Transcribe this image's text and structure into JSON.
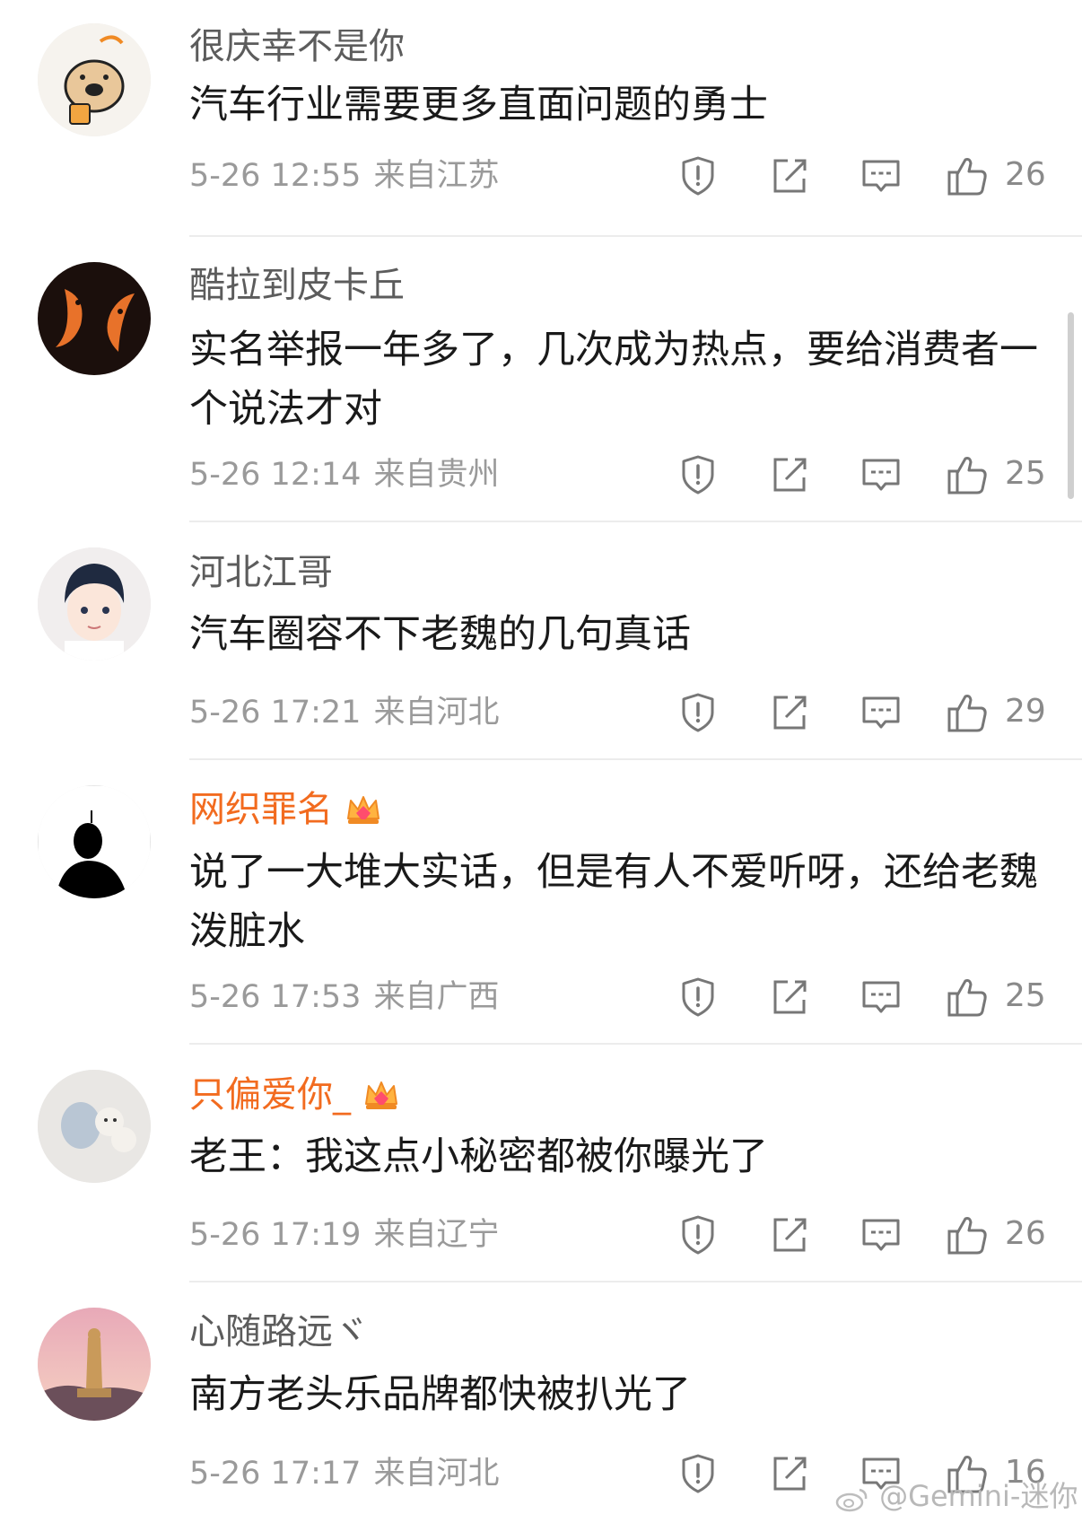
{
  "comments": [
    {
      "username": "很庆幸不是你",
      "vip": false,
      "text": "汽车行业需要更多直面问题的勇士",
      "time": "5-26 12:55",
      "location": "来自江苏",
      "likes": "26"
    },
    {
      "username": "酷拉到皮卡丘",
      "vip": false,
      "text": "实名举报一年多了，几次成为热点，要给消费者一个说法才对",
      "time": "5-26 12:14",
      "location": "来自贵州",
      "likes": "25"
    },
    {
      "username": "河北江哥",
      "vip": false,
      "text": "汽车圈容不下老魏的几句真话",
      "time": "5-26 17:21",
      "location": "来自河北",
      "likes": "29"
    },
    {
      "username": "网织罪名",
      "vip": true,
      "text": "说了一大堆大实话，但是有人不爱听呀，还给老魏泼脏水",
      "time": "5-26 17:53",
      "location": "来自广西",
      "likes": "25"
    },
    {
      "username": "只偏爱你_",
      "vip": true,
      "text": "老王：我这点小秘密都被你曝光了",
      "time": "5-26 17:19",
      "location": "来自辽宁",
      "likes": "26"
    },
    {
      "username": "心随路远ヾ",
      "vip": false,
      "text": "南方老头乐品牌都快被扒光了",
      "time": "5-26 17:17",
      "location": "来自河北",
      "likes": "16"
    }
  ],
  "icons": {
    "report": "report-icon",
    "repost": "repost-icon",
    "reply": "reply-icon",
    "like": "like-icon",
    "vip": "crown-icon"
  },
  "colors": {
    "vip_name": "#f26b1f",
    "name": "#5c5c5c",
    "meta": "#9a9a9a"
  },
  "watermark": "@Gemini-迷你"
}
